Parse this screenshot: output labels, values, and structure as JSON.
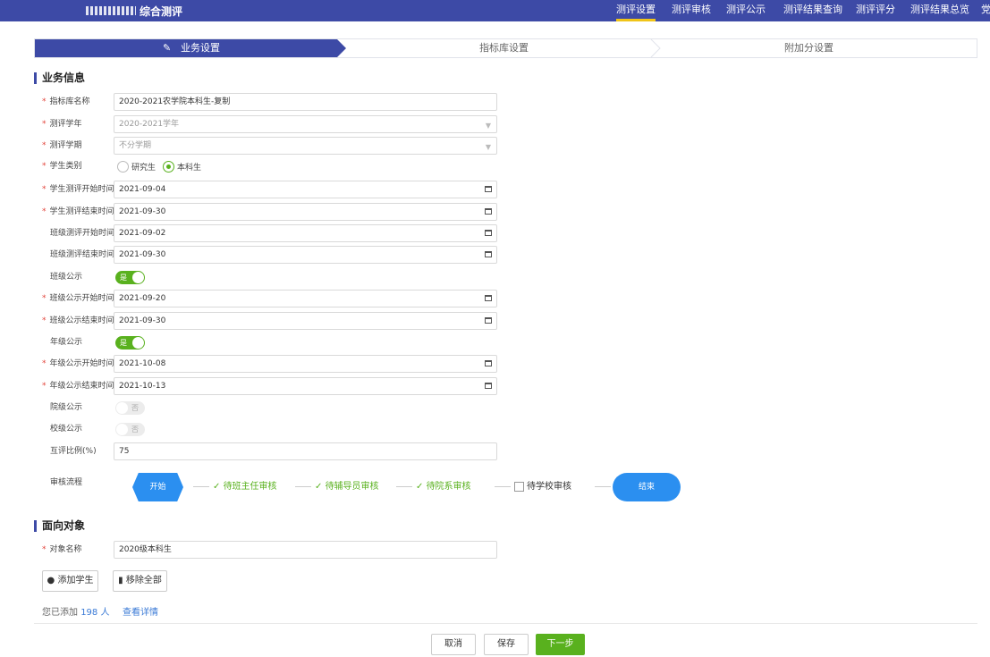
{
  "header": {
    "title": "综合测评",
    "nav": [
      "测评设置",
      "测评审核",
      "测评公示",
      "测评结果查询",
      "测评评分",
      "测评结果总览"
    ],
    "nav_tail": "党"
  },
  "steps": [
    "业务设置",
    "指标库设置",
    "附加分设置"
  ],
  "business": {
    "title": "业务信息",
    "fields": [
      {
        "label": "指标库名称",
        "value": "2020-2021农学院本科生-复制"
      },
      {
        "label": "测评学年",
        "value": "2020-2021学年"
      },
      {
        "label": "测评学期",
        "value": "不分学期"
      },
      {
        "label": "学生类别"
      },
      {
        "label": "学生测评开始时间",
        "value": "2021-09-04"
      },
      {
        "label": "学生测评结束时间",
        "value": "2021-09-30"
      },
      {
        "label": "班级测评开始时间",
        "value": "2021-09-02"
      },
      {
        "label": "班级测评结束时间",
        "value": "2021-09-30"
      },
      {
        "label": "班级公示",
        "toggle": "是"
      },
      {
        "label": "班级公示开始时间",
        "value": "2021-09-20"
      },
      {
        "label": "班级公示结束时间",
        "value": "2021-09-30"
      },
      {
        "label": "年级公示",
        "toggle": "是"
      },
      {
        "label": "年级公示开始时间",
        "value": "2021-10-08"
      },
      {
        "label": "年级公示结束时间",
        "value": "2021-10-13"
      },
      {
        "label": "院级公示",
        "toggle": "否"
      },
      {
        "label": "校级公示",
        "toggle": "否"
      },
      {
        "label": "互评比例(%)",
        "value": "75"
      },
      {
        "label": "审核流程"
      }
    ],
    "student_types": [
      "研究生",
      "本科生"
    ],
    "flow": [
      "开始",
      "待班主任审核",
      "待辅导员审核",
      "待院系审核",
      "待学校审核",
      "结束"
    ]
  },
  "target": {
    "title": "面向对象",
    "label": "对象名称",
    "value": "2020级本科生",
    "add_btn": "添加学生",
    "remove_btn": "移除全部",
    "added_prefix": "您已添加",
    "count": "198 人",
    "detail_link": "查看详情"
  },
  "footer": {
    "cancel": "取消",
    "save": "保存",
    "next": "下一步"
  },
  "colors": {
    "brand": "#3d4aa6",
    "success": "#59b11e",
    "flow_blue": "#2b8ff0",
    "required": "#e2443b"
  }
}
